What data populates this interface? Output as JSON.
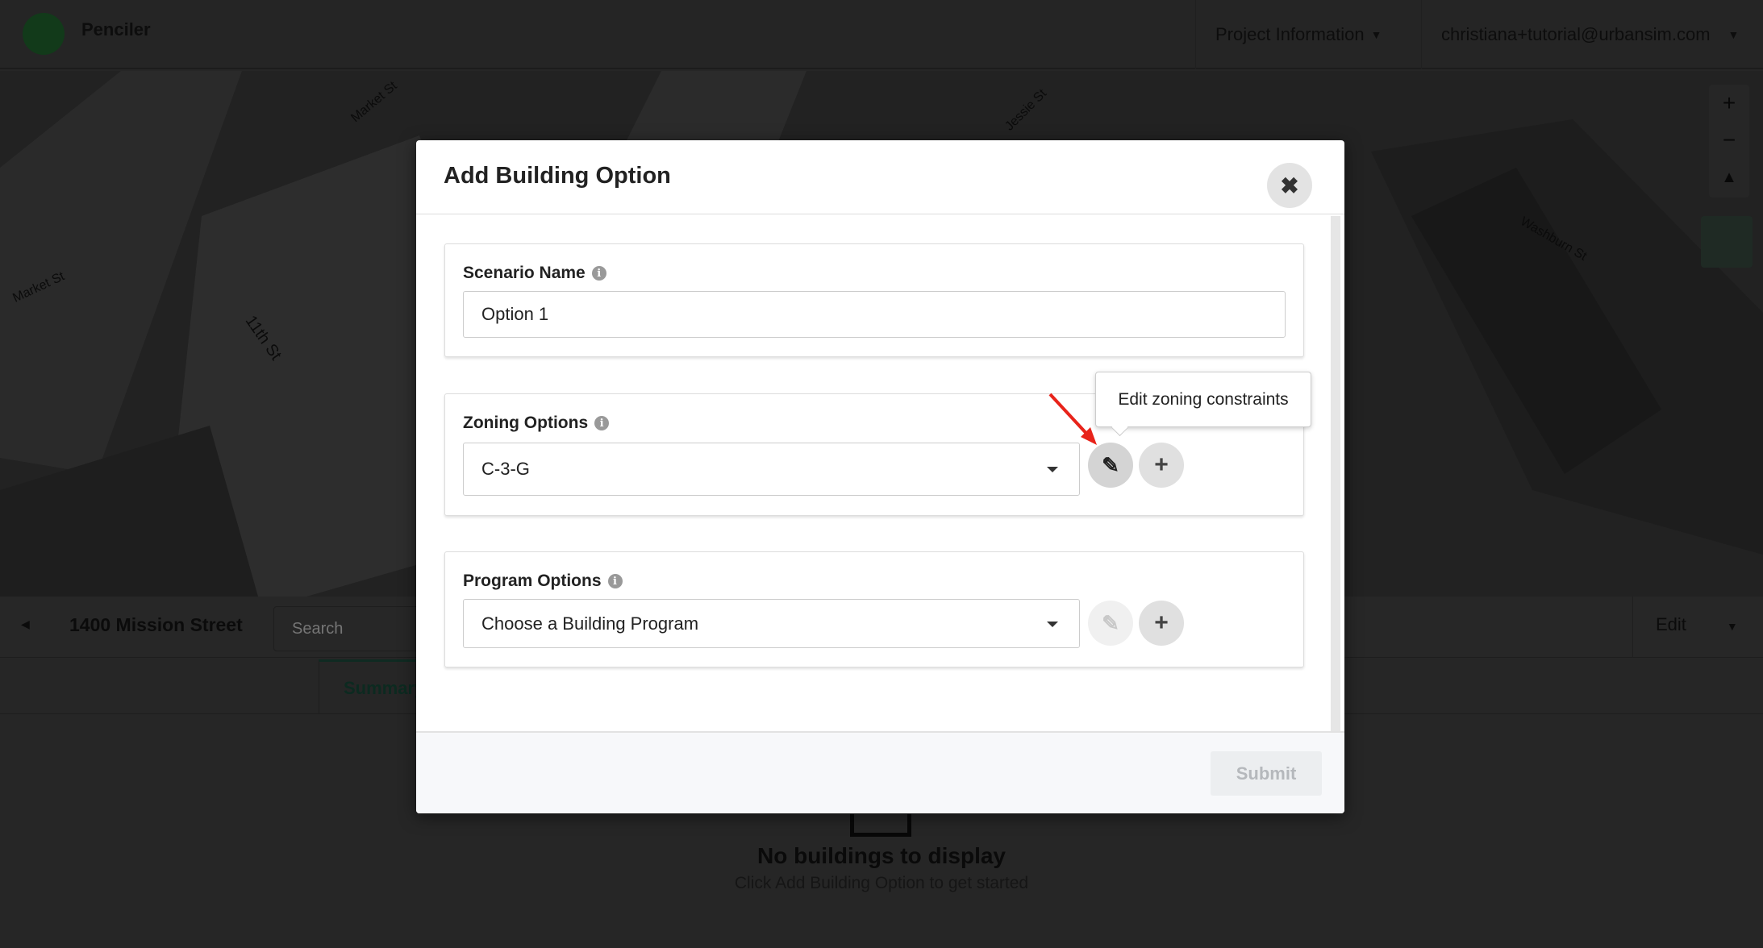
{
  "header": {
    "brand": "Penciler",
    "project_menu": "Project Information",
    "user_menu": "christiana+tutorial@urbansim.com"
  },
  "map": {
    "labels": [
      "Market St",
      "Jessie St",
      "11th St",
      "Washburn St",
      "Market St"
    ],
    "zoom_in": "+",
    "zoom_out": "−"
  },
  "panel": {
    "address": "1400 Mission Street",
    "search_placeholder": "Search",
    "edit_label": "Edit",
    "tab_summary": "Summary",
    "empty_title": "No buildings to display",
    "empty_subtitle": "Click Add Building Option to get started"
  },
  "modal": {
    "title": "Add Building Option",
    "scenario": {
      "label": "Scenario Name",
      "value": "Option 1"
    },
    "zoning": {
      "label": "Zoning Options",
      "value": "C-3-G",
      "tooltip": "Edit zoning constraints"
    },
    "program": {
      "label": "Program Options",
      "value": "Choose a Building Program"
    },
    "submit": "Submit"
  },
  "colors": {
    "annotation_arrow": "#e8231a",
    "overlay": "#262626",
    "footer_bg": "#f7f8fa"
  }
}
